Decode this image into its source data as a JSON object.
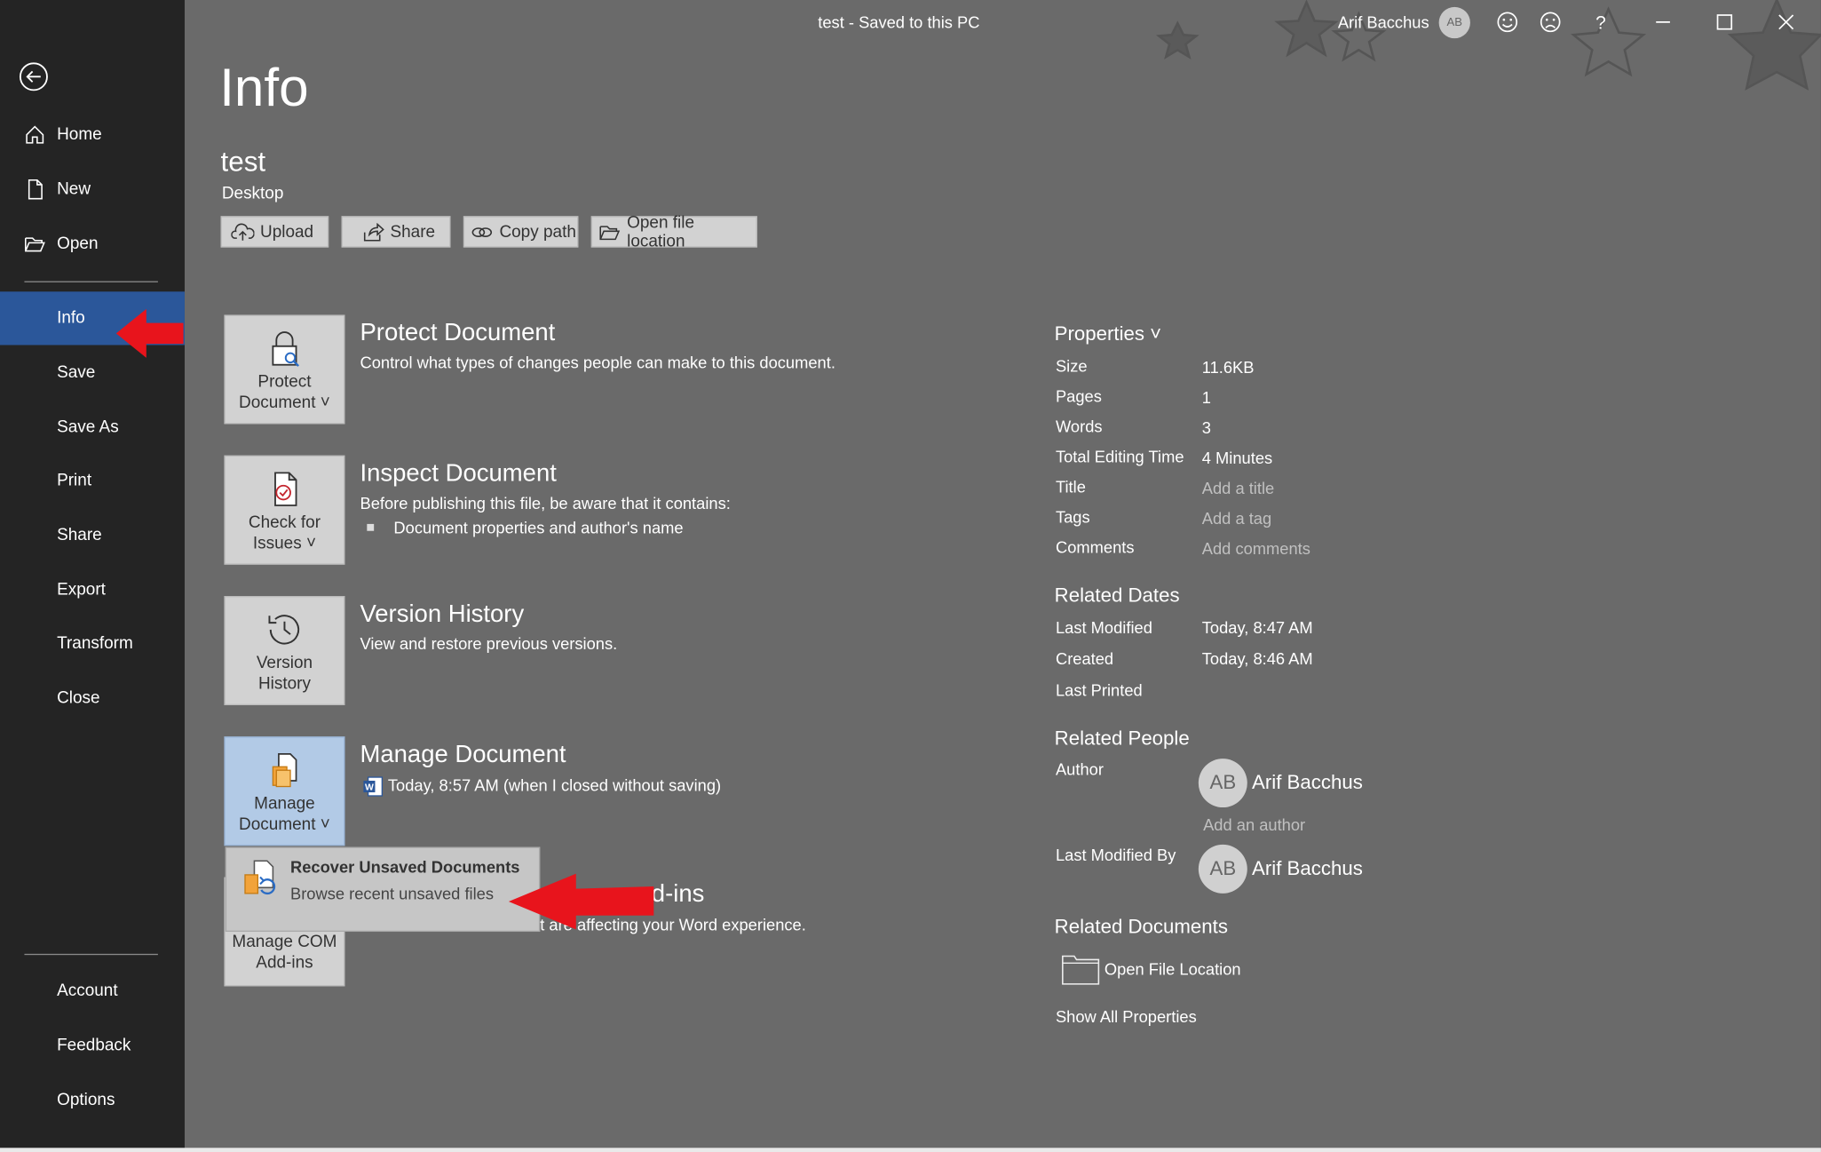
{
  "window": {
    "title": "test  -  Saved to this PC",
    "user_name": "Arif Bacchus",
    "user_initials": "AB",
    "icons": [
      "smiley-icon",
      "frown-icon",
      "help-icon",
      "minimize-icon",
      "maximize-icon",
      "close-icon"
    ]
  },
  "sidebar": {
    "items": [
      {
        "label": "Home",
        "icon": "home-icon"
      },
      {
        "label": "New",
        "icon": "new-document-icon"
      },
      {
        "label": "Open",
        "icon": "open-folder-icon"
      },
      {
        "label": "Info"
      },
      {
        "label": "Save"
      },
      {
        "label": "Save As"
      },
      {
        "label": "Print"
      },
      {
        "label": "Share"
      },
      {
        "label": "Export"
      },
      {
        "label": "Transform"
      },
      {
        "label": "Close"
      },
      {
        "label": "Account"
      },
      {
        "label": "Feedback"
      },
      {
        "label": "Options"
      }
    ],
    "active": "Info"
  },
  "page": {
    "heading": "Info",
    "doc_name": "test",
    "doc_location": "Desktop",
    "toolbar": {
      "upload": "Upload",
      "share": "Share",
      "copy_path": "Copy path",
      "open_location": "Open file location"
    }
  },
  "sections": {
    "protect": {
      "button_line1": "Protect",
      "button_line2": "Document ˅",
      "title": "Protect Document",
      "desc": "Control what types of changes people can make to this document."
    },
    "inspect": {
      "button_line1": "Check for",
      "button_line2": "Issues ˅",
      "title": "Inspect Document",
      "desc": "Before publishing this file, be aware that it contains:",
      "bullet": "Document properties and author's name"
    },
    "version": {
      "button_line1": "Version",
      "button_line2": "History",
      "title": "Version History",
      "desc": "View and restore previous versions."
    },
    "manage": {
      "button_line1": "Manage",
      "button_line2": "Document ˅",
      "title": "Manage Document",
      "entry": "Today, 8:57 AM (when I closed without saving)"
    },
    "com": {
      "button_line1": "Manage COM",
      "button_line2": "Add-ins",
      "title_fragment": "d-ins",
      "desc_fragment": "t are affecting your Word experience."
    }
  },
  "dropdown": {
    "title": "Recover Unsaved Documents",
    "subtitle": "Browse recent unsaved files"
  },
  "properties": {
    "header": "Properties ˅",
    "rows": [
      {
        "label": "Size",
        "value": "11.6KB"
      },
      {
        "label": "Pages",
        "value": "1"
      },
      {
        "label": "Words",
        "value": "3"
      },
      {
        "label": "Total Editing Time",
        "value": "4 Minutes"
      },
      {
        "label": "Title",
        "value": "Add a title"
      },
      {
        "label": "Tags",
        "value": "Add a tag"
      },
      {
        "label": "Comments",
        "value": "Add comments"
      }
    ],
    "related_dates_header": "Related Dates",
    "dates": [
      {
        "label": "Last Modified",
        "value": "Today, 8:47 AM"
      },
      {
        "label": "Created",
        "value": "Today, 8:46 AM"
      },
      {
        "label": "Last Printed",
        "value": ""
      }
    ],
    "related_people_header": "Related People",
    "author_label": "Author",
    "author_initials": "AB",
    "author_name": "Arif Bacchus",
    "add_author": "Add an author",
    "last_modified_by_label": "Last Modified By",
    "modifier_initials": "AB",
    "modifier_name": "Arif Bacchus",
    "related_docs_header": "Related Documents",
    "open_file_location": "Open File Location",
    "show_all": "Show All Properties"
  },
  "annotations": {
    "arrow_color": "#e8141c"
  }
}
